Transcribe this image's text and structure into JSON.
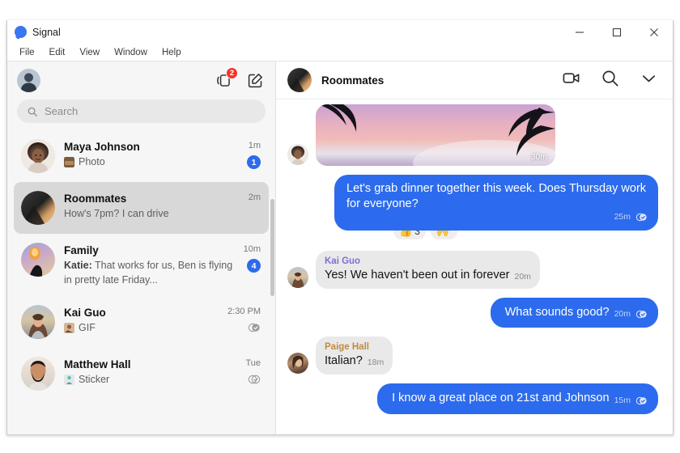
{
  "window": {
    "title": "Signal",
    "logo_icon": "signal-logo-icon",
    "controls": {
      "minimize": "minimize-icon",
      "maximize": "maximize-icon",
      "close": "close-icon"
    }
  },
  "menubar": {
    "items": [
      "File",
      "Edit",
      "View",
      "Window",
      "Help"
    ]
  },
  "sidebar": {
    "toolbar": {
      "profile_avatar": "profile-avatar",
      "stories_icon": "stories-icon",
      "stories_badge": "2",
      "compose_icon": "compose-icon"
    },
    "search": {
      "placeholder": "Search",
      "value": "",
      "icon": "search-icon"
    },
    "conversations": [
      {
        "name": "Maya Johnson",
        "snippet": "Photo",
        "snippet_prefix": "",
        "has_thumb": true,
        "time": "1m",
        "unread": "1",
        "receipt": "",
        "selected": false
      },
      {
        "name": "Roommates",
        "snippet": "How's 7pm? I can drive",
        "snippet_prefix": "",
        "has_thumb": false,
        "time": "2m",
        "unread": "",
        "receipt": "",
        "selected": true
      },
      {
        "name": "Family",
        "snippet": "That works for us, Ben is flying in pretty late Friday...",
        "snippet_prefix": "Katie:",
        "has_thumb": false,
        "time": "10m",
        "unread": "4",
        "receipt": "",
        "selected": false
      },
      {
        "name": "Kai Guo",
        "snippet": "GIF",
        "snippet_prefix": "",
        "has_thumb": true,
        "time": "2:30 PM",
        "unread": "",
        "receipt": "read-receipt-icon",
        "selected": false
      },
      {
        "name": "Matthew Hall",
        "snippet": "Sticker",
        "snippet_prefix": "",
        "has_thumb": true,
        "time": "Tue",
        "unread": "",
        "receipt": "read-receipt-icon",
        "selected": false
      }
    ]
  },
  "chat": {
    "header": {
      "title": "Roommates",
      "avatar": "group-avatar",
      "video_icon": "video-call-icon",
      "search_icon": "search-icon",
      "chevron_icon": "chevron-down-icon"
    },
    "messages": [
      {
        "type": "image",
        "direction": "in",
        "sender": "",
        "text": "",
        "time": "30m"
      },
      {
        "type": "text",
        "direction": "out",
        "sender": "",
        "text": "Let's grab dinner together this week. Does Thursday work for everyone?",
        "time": "25m",
        "receipt": "read-receipt-icon",
        "reactions": [
          {
            "emoji": "👍",
            "count": "3"
          },
          {
            "emoji": "🙌",
            "count": ""
          }
        ]
      },
      {
        "type": "text",
        "direction": "in",
        "sender": "Kai Guo",
        "sender_color": "#7c6fd6",
        "text": "Yes! We haven't been out in forever",
        "time": "20m"
      },
      {
        "type": "text",
        "direction": "out",
        "sender": "",
        "text": "What sounds good?",
        "time": "20m",
        "receipt": "read-receipt-icon"
      },
      {
        "type": "text",
        "direction": "in",
        "sender": "Paige Hall",
        "sender_color": "#c08a3e",
        "text": "Italian?",
        "time": "18m"
      },
      {
        "type": "text",
        "direction": "out",
        "sender": "",
        "text": "I know a great place on 21st and Johnson",
        "time": "15m",
        "receipt": "read-receipt-icon"
      }
    ]
  },
  "colors": {
    "accent_blue": "#2c6bed",
    "badge_red": "#f4342b",
    "sidebar_bg": "#f6f6f6",
    "selected_bg": "#d8d8d8",
    "bubble_in_bg": "#e9e9e9"
  }
}
